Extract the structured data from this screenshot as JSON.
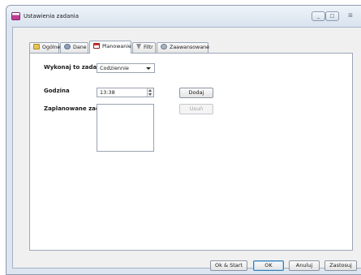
{
  "window": {
    "title": "Ustawienia zadania",
    "minimize_glyph": "_",
    "maximize_glyph": "□",
    "close_glyph": "⊠"
  },
  "tabs": [
    {
      "label": "Ogólne",
      "icon": "folder-icon"
    },
    {
      "label": "Dane",
      "icon": "database-icon"
    },
    {
      "label": "Planowanie",
      "icon": "calendar-icon",
      "active": true
    },
    {
      "label": "Filtr",
      "icon": "filter-icon"
    },
    {
      "label": "Zaawansowane",
      "icon": "gear-icon"
    }
  ],
  "schedule": {
    "run_label": "Wykonaj to zadanie:",
    "run_value": "Codziennie",
    "time_label": "Godzina",
    "time_value": "13:38",
    "add_button": "Dodaj",
    "scheduled_label": "Zaplanowane zadanie dz",
    "remove_button": "Usuń",
    "scheduled_items": []
  },
  "footer": {
    "ok_start": "Ok & Start",
    "ok": "OK",
    "cancel": "Anuluj",
    "apply": "Zastosuj"
  }
}
